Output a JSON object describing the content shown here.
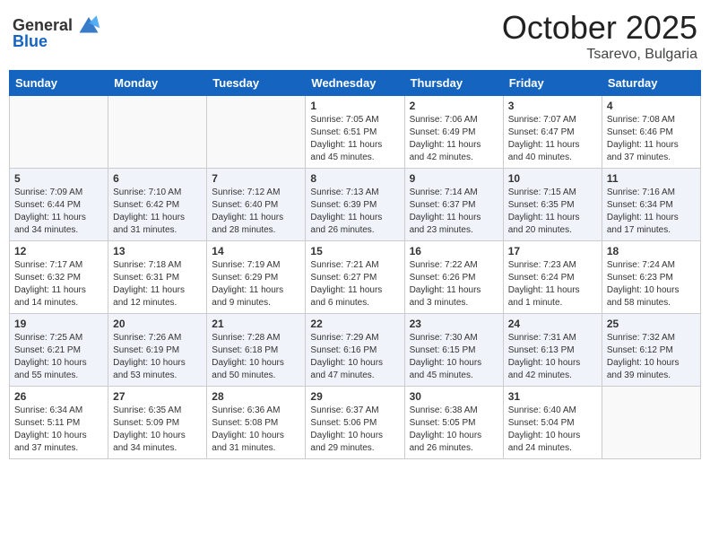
{
  "header": {
    "logo_general": "General",
    "logo_blue": "Blue",
    "month": "October 2025",
    "location": "Tsarevo, Bulgaria"
  },
  "days_of_week": [
    "Sunday",
    "Monday",
    "Tuesday",
    "Wednesday",
    "Thursday",
    "Friday",
    "Saturday"
  ],
  "weeks": [
    [
      {
        "day": "",
        "info": ""
      },
      {
        "day": "",
        "info": ""
      },
      {
        "day": "",
        "info": ""
      },
      {
        "day": "1",
        "info": "Sunrise: 7:05 AM\nSunset: 6:51 PM\nDaylight: 11 hours and 45 minutes."
      },
      {
        "day": "2",
        "info": "Sunrise: 7:06 AM\nSunset: 6:49 PM\nDaylight: 11 hours and 42 minutes."
      },
      {
        "day": "3",
        "info": "Sunrise: 7:07 AM\nSunset: 6:47 PM\nDaylight: 11 hours and 40 minutes."
      },
      {
        "day": "4",
        "info": "Sunrise: 7:08 AM\nSunset: 6:46 PM\nDaylight: 11 hours and 37 minutes."
      }
    ],
    [
      {
        "day": "5",
        "info": "Sunrise: 7:09 AM\nSunset: 6:44 PM\nDaylight: 11 hours and 34 minutes."
      },
      {
        "day": "6",
        "info": "Sunrise: 7:10 AM\nSunset: 6:42 PM\nDaylight: 11 hours and 31 minutes."
      },
      {
        "day": "7",
        "info": "Sunrise: 7:12 AM\nSunset: 6:40 PM\nDaylight: 11 hours and 28 minutes."
      },
      {
        "day": "8",
        "info": "Sunrise: 7:13 AM\nSunset: 6:39 PM\nDaylight: 11 hours and 26 minutes."
      },
      {
        "day": "9",
        "info": "Sunrise: 7:14 AM\nSunset: 6:37 PM\nDaylight: 11 hours and 23 minutes."
      },
      {
        "day": "10",
        "info": "Sunrise: 7:15 AM\nSunset: 6:35 PM\nDaylight: 11 hours and 20 minutes."
      },
      {
        "day": "11",
        "info": "Sunrise: 7:16 AM\nSunset: 6:34 PM\nDaylight: 11 hours and 17 minutes."
      }
    ],
    [
      {
        "day": "12",
        "info": "Sunrise: 7:17 AM\nSunset: 6:32 PM\nDaylight: 11 hours and 14 minutes."
      },
      {
        "day": "13",
        "info": "Sunrise: 7:18 AM\nSunset: 6:31 PM\nDaylight: 11 hours and 12 minutes."
      },
      {
        "day": "14",
        "info": "Sunrise: 7:19 AM\nSunset: 6:29 PM\nDaylight: 11 hours and 9 minutes."
      },
      {
        "day": "15",
        "info": "Sunrise: 7:21 AM\nSunset: 6:27 PM\nDaylight: 11 hours and 6 minutes."
      },
      {
        "day": "16",
        "info": "Sunrise: 7:22 AM\nSunset: 6:26 PM\nDaylight: 11 hours and 3 minutes."
      },
      {
        "day": "17",
        "info": "Sunrise: 7:23 AM\nSunset: 6:24 PM\nDaylight: 11 hours and 1 minute."
      },
      {
        "day": "18",
        "info": "Sunrise: 7:24 AM\nSunset: 6:23 PM\nDaylight: 10 hours and 58 minutes."
      }
    ],
    [
      {
        "day": "19",
        "info": "Sunrise: 7:25 AM\nSunset: 6:21 PM\nDaylight: 10 hours and 55 minutes."
      },
      {
        "day": "20",
        "info": "Sunrise: 7:26 AM\nSunset: 6:19 PM\nDaylight: 10 hours and 53 minutes."
      },
      {
        "day": "21",
        "info": "Sunrise: 7:28 AM\nSunset: 6:18 PM\nDaylight: 10 hours and 50 minutes."
      },
      {
        "day": "22",
        "info": "Sunrise: 7:29 AM\nSunset: 6:16 PM\nDaylight: 10 hours and 47 minutes."
      },
      {
        "day": "23",
        "info": "Sunrise: 7:30 AM\nSunset: 6:15 PM\nDaylight: 10 hours and 45 minutes."
      },
      {
        "day": "24",
        "info": "Sunrise: 7:31 AM\nSunset: 6:13 PM\nDaylight: 10 hours and 42 minutes."
      },
      {
        "day": "25",
        "info": "Sunrise: 7:32 AM\nSunset: 6:12 PM\nDaylight: 10 hours and 39 minutes."
      }
    ],
    [
      {
        "day": "26",
        "info": "Sunrise: 6:34 AM\nSunset: 5:11 PM\nDaylight: 10 hours and 37 minutes."
      },
      {
        "day": "27",
        "info": "Sunrise: 6:35 AM\nSunset: 5:09 PM\nDaylight: 10 hours and 34 minutes."
      },
      {
        "day": "28",
        "info": "Sunrise: 6:36 AM\nSunset: 5:08 PM\nDaylight: 10 hours and 31 minutes."
      },
      {
        "day": "29",
        "info": "Sunrise: 6:37 AM\nSunset: 5:06 PM\nDaylight: 10 hours and 29 minutes."
      },
      {
        "day": "30",
        "info": "Sunrise: 6:38 AM\nSunset: 5:05 PM\nDaylight: 10 hours and 26 minutes."
      },
      {
        "day": "31",
        "info": "Sunrise: 6:40 AM\nSunset: 5:04 PM\nDaylight: 10 hours and 24 minutes."
      },
      {
        "day": "",
        "info": ""
      }
    ]
  ]
}
